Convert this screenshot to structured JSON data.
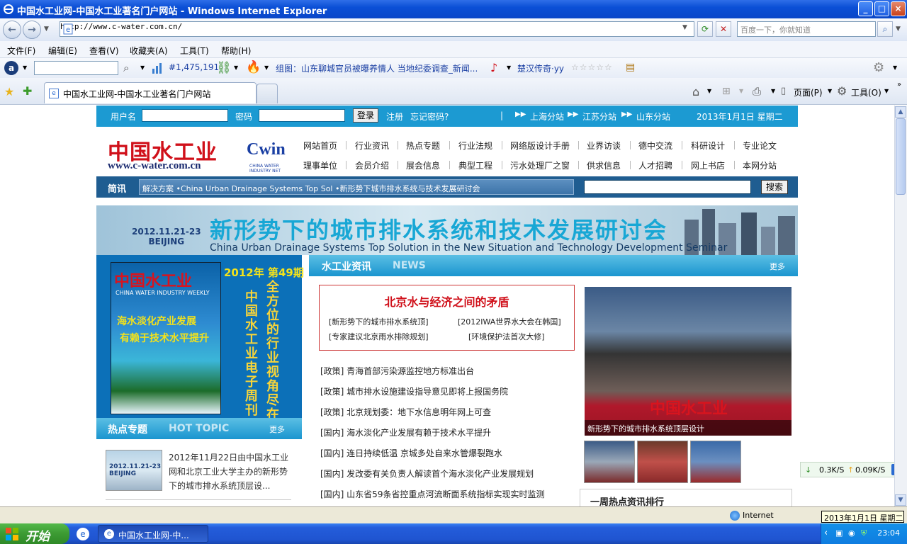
{
  "window": {
    "title": "中国水工业网-中国水工业著名门户网站 - Windows Internet Explorer",
    "minimize": "_",
    "maximize": "□",
    "close": "×"
  },
  "address_bar": {
    "url": "http://www.c-water.com.cn/",
    "search_placeholder": "百度一下，你就知道"
  },
  "menu": [
    "文件(F)",
    "编辑(E)",
    "查看(V)",
    "收藏夹(A)",
    "工具(T)",
    "帮助(H)"
  ],
  "toolbar": {
    "rank": "#1,475,191",
    "news_link": "组图：山东聊城官员被曝养情人 当地纪委调查_新闻...",
    "music_link": "楚汉传奇·yy"
  },
  "tabs": {
    "active_title": "中国水工业网-中国水工业著名门户网站"
  },
  "ie_commands": {
    "page": "页面(P)",
    "tools": "工具(O)"
  },
  "site": {
    "top": {
      "username_label": "用户名",
      "password_label": "密码",
      "login_button": "登录",
      "register": "注册",
      "forgot": "忘记密码?",
      "branches": [
        "上海分站",
        "江苏分站",
        "山东分站"
      ],
      "date": "2013年1月1日 星期二"
    },
    "logo": {
      "cn": "中国水工业",
      "en": "Cwin",
      "url": "www.c-water.com.cn",
      "sub": "CHINA WATER INDUSTRY NET"
    },
    "nav_row1": [
      "网站首页",
      "行业资讯",
      "热点专题",
      "行业法规",
      "网络版设计手册",
      "业界访谈",
      "德中交流",
      "科研设计",
      "专业论文"
    ],
    "nav_row2": [
      "理事单位",
      "会员介绍",
      "展会信息",
      "典型工程",
      "污水处理厂之窗",
      "供求信息",
      "人才招聘",
      "网上书店",
      "本网分站"
    ],
    "brief": {
      "label": "简讯",
      "ticker": "解决方案 •China Urban Drainage Systems Top Sol •新形势下城市排水系统与技术发展研讨会",
      "search_button": "搜索"
    },
    "banner": {
      "date": "2012.11.21-23",
      "city": "BEIJING",
      "title": "新形势下的城市排水系统和技术发展研讨会",
      "english": "China Urban Drainage Systems Top Solution in the New Situation and Technology Development Seminar"
    },
    "magazine": {
      "title": "中国水工业",
      "issue": "2012年 第49期",
      "subtitle": "CHINA WATER INDUSTRY WEEKLY",
      "headline1": "海水淡化产业发展",
      "headline2": "有赖于技术水平提升",
      "vertical1": "中国水工业电子周刊",
      "vertical2": "全方位的行业视角尽在"
    },
    "news_section": {
      "title_cn": "水工业资讯",
      "title_en": "NEWS",
      "more": "更多",
      "headline": "北京水与经济之间的矛盾",
      "links": [
        "[新形势下的城市排水系统顶]",
        "[2012IWA世界水大会在韩国]",
        "[专家建议北京雨水排除规划]",
        "[环境保护法首次大修]"
      ],
      "items": [
        "[政策] 青海首部污染源监控地方标准出台",
        "[政策] 城市排水设施建设指导意见即将上报国务院",
        "[政策] 北京规划委：地下水信息明年网上可查",
        "[国内] 海水淡化产业发展有赖于技术水平提升",
        "[国内] 连日持续低温 京城多处自来水管爆裂跑水",
        "[国内] 发改委有关负责人解读首个海水淡化产业发展规划",
        "[国内] 山东省59条省控重点河流断面系统指标实现实时监测"
      ]
    },
    "photo": {
      "caption": "新形势下的城市排水系统顶层设计",
      "watermark": "中国水工业"
    },
    "hot_topic": {
      "title_cn": "热点专题",
      "title_en": "HOT TOPIC",
      "more": "更多",
      "image_text": "2012.11.21-23 BEIJING",
      "text": "2012年11月22日由中国水工业网和北京工业大学主办的新形势下的城市排水系统顶层设..."
    },
    "rank_title": "一周热点资讯排行"
  },
  "download_speed": {
    "down": "0.3K/S",
    "up": "0.09K/S"
  },
  "status": {
    "zone": "Internet",
    "tooltip": "2013年1月1日 星期二"
  },
  "taskbar": {
    "start": "开始",
    "item": "中国水工业网-中...",
    "clock": "23:04"
  },
  "colors": {
    "site_blue": "#1c9ad2",
    "brand_red": "#d0101a",
    "ie_blue": "#0b4fd6"
  }
}
